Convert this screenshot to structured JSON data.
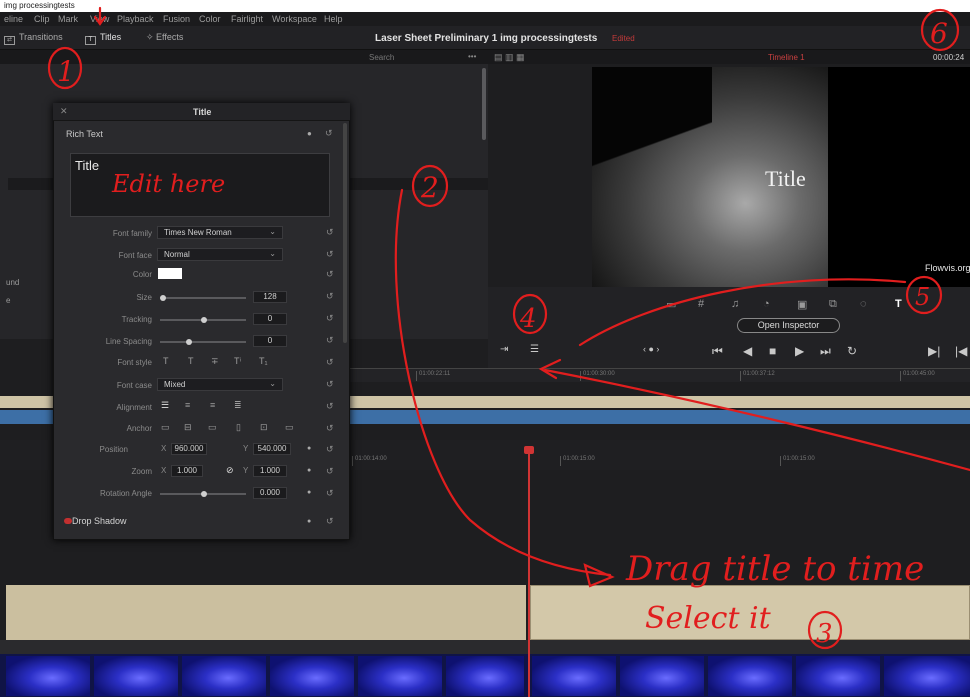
{
  "app": {
    "window_title": "img processingtests",
    "project_title": "Laser Sheet Preliminary 1 img processingtests",
    "project_status": "Edited"
  },
  "menu": [
    "eline",
    "Clip",
    "Mark",
    "View",
    "Playback",
    "Fusion",
    "Color",
    "Fairlight",
    "Workspace",
    "Help"
  ],
  "toolbar": {
    "transitions": "Transitions",
    "titles": "Titles",
    "effects": "Effects",
    "search_placeholder": "Search",
    "timeline_name": "Timeline 1",
    "timecode": "00:00:24"
  },
  "viewer": {
    "overlay_title": "Title",
    "watermark": "Flowvis.org",
    "open_inspector": "Open Inspector"
  },
  "inspector": {
    "header": "Title",
    "section_rich_text": "Rich Text",
    "text_value": "Title",
    "font_family_label": "Font family",
    "font_family_value": "Times New Roman",
    "font_face_label": "Font face",
    "font_face_value": "Normal",
    "color_label": "Color",
    "size_label": "Size",
    "size_value": "128",
    "tracking_label": "Tracking",
    "tracking_value": "0",
    "line_spacing_label": "Line Spacing",
    "line_spacing_value": "0",
    "font_style_label": "Font style",
    "font_case_label": "Font case",
    "font_case_value": "Mixed",
    "alignment_label": "Alignment",
    "anchor_label": "Anchor",
    "position_label": "Position",
    "position_x": "960.000",
    "position_y": "540.000",
    "zoom_label": "Zoom",
    "zoom_x": "1.000",
    "zoom_y": "1.000",
    "rotation_label": "Rotation Angle",
    "rotation_value": "0.000",
    "section_drop_shadow": "Drop Shadow",
    "axis_x": "X",
    "axis_y": "Y"
  },
  "left_panel_fragments": {
    "line1": "und",
    "line2": "e"
  },
  "timeline_ticks_upper": [
    "01:00:22:11",
    "01:00:30:00",
    "01:00:37:12",
    "01:00:45:00"
  ],
  "timeline_ticks_lower": [
    "01:00:14:00",
    "01:00:15:00",
    "01:00:15:00"
  ],
  "annotations": {
    "n1": "1",
    "n2": "2",
    "n3": "3",
    "n4": "4",
    "n5": "5",
    "n6": "6",
    "edit_here": "Edit here",
    "drag_title": "Drag title to time",
    "select_it": "Select it"
  },
  "colors": {
    "accent_red": "#e11e1e",
    "playhead": "#d03434",
    "track_tan": "#cbbf9f",
    "track_blue": "#3d6fa6",
    "clip_blue": "#2b2fc6"
  }
}
